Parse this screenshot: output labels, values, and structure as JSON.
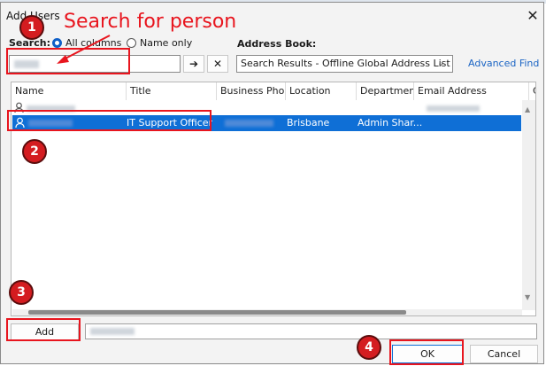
{
  "dialog": {
    "title": "Add Users",
    "close_glyph": "✕"
  },
  "search": {
    "label": "Search:",
    "option_all": "All columns",
    "option_name": "Name only",
    "go_glyph": "➔",
    "clear_glyph": "✕"
  },
  "address_book": {
    "label": "Address Book:",
    "selected": "Search Results - Offline Global Address List",
    "advanced_find": "Advanced Find"
  },
  "columns": [
    "Name",
    "Title",
    "Business Phone",
    "Location",
    "Department",
    "Email Address",
    "C"
  ],
  "selected_row": {
    "title": "IT Support Officer",
    "location": "Brisbane",
    "department": "Admin Shar..."
  },
  "buttons": {
    "add": "Add",
    "ok": "OK",
    "cancel": "Cancel"
  },
  "annotations": {
    "headline": "Search for person",
    "steps": [
      "1",
      "2",
      "3",
      "4"
    ],
    "color": "#e8151e"
  },
  "icons": [
    "person-icon",
    "arrow-right-icon",
    "close-icon",
    "chevron-down-icon",
    "scroll-up-icon",
    "scroll-down-icon"
  ]
}
